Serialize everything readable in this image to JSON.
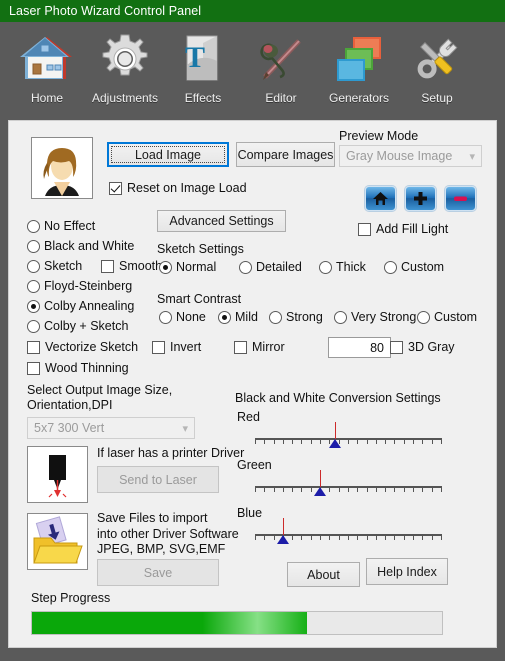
{
  "window": {
    "title": "Laser Photo Wizard Control Panel"
  },
  "toolbar": {
    "items": [
      {
        "label": "Home",
        "icon": "house-icon"
      },
      {
        "label": "Adjustments",
        "icon": "gear-icon"
      },
      {
        "label": "Effects",
        "icon": "text-book-icon"
      },
      {
        "label": "Editor",
        "icon": "pen-pencil-icon"
      },
      {
        "label": "Generators",
        "icon": "layers-icon"
      },
      {
        "label": "Setup",
        "icon": "wrench-screwdriver-icon"
      }
    ]
  },
  "main": {
    "load_image_label": "Load Image",
    "compare_images_label": "Compare Images",
    "reset_on_image_load": {
      "label": "Reset on Image Load",
      "checked": true
    },
    "advanced_settings_label": "Advanced Settings",
    "preview_mode": {
      "label": "Preview Mode",
      "value": "Gray Mouse Image",
      "disabled": true
    },
    "nav_buttons": [
      {
        "name": "home",
        "icon": "home-icon"
      },
      {
        "name": "zoom-in",
        "icon": "plus-icon"
      },
      {
        "name": "zoom-out",
        "icon": "minus-icon"
      }
    ],
    "add_fill_light": {
      "label": "Add Fill Light",
      "checked": false
    },
    "effects": {
      "selected": "Colby Annealing",
      "options": [
        "No Effect",
        "Black and White",
        "Sketch",
        "Floyd-Steinberg",
        "Colby Annealing",
        "Colby + Sketch"
      ]
    },
    "smooth": {
      "label": "Smooth",
      "checked": false
    },
    "sketch_settings": {
      "label": "Sketch Settings",
      "selected": "Normal",
      "options": [
        "Normal",
        "Detailed",
        "Thick",
        "Custom"
      ]
    },
    "smart_contrast": {
      "label": "Smart Contrast",
      "selected": "Mild",
      "options": [
        "None",
        "Mild",
        "Strong",
        "Very Strong",
        "Custom"
      ]
    },
    "vectorize_sketch": {
      "label": "Vectorize Sketch",
      "checked": false
    },
    "wood_thinning": {
      "label": "Wood Thinning",
      "checked": false
    },
    "invert": {
      "label": "Invert",
      "checked": false
    },
    "mirror": {
      "label": "Mirror",
      "checked": false
    },
    "threshold_value": "80",
    "three_d_gray": {
      "label": "3D Gray",
      "checked": false
    },
    "output_size": {
      "label_line1": "Select Output Image Size,",
      "label_line2": "Orientation,DPI",
      "value": "5x7 300 Vert",
      "disabled": true
    },
    "laser": {
      "note": "If laser has a printer Driver",
      "button_label": "Send to Laser",
      "disabled": true,
      "icon": "laser-head-icon"
    },
    "save": {
      "note_line1": "Save Files to import",
      "note_line2": " into other Driver Software",
      "note_line3": "JPEG, BMP, SVG,EMF",
      "button_label": "Save",
      "disabled": true,
      "icon": "save-folder-icon"
    },
    "bw_conversion": {
      "title": "Black and White Conversion Settings",
      "channels": [
        {
          "label": "Red",
          "position": 43
        },
        {
          "label": "Green",
          "position": 35
        },
        {
          "label": "Blue",
          "position": 15
        }
      ],
      "tick_count": 21
    },
    "about_label": "About",
    "help_index_label": "Help Index",
    "step_progress": {
      "label": "Step Progress",
      "percent": 67
    },
    "thumbnail": {
      "icon": "person-avatar-icon"
    }
  },
  "colors": {
    "titlebar": "#127012",
    "toolbar_bg": "#5a5a5a",
    "panel_bg": "#f0f0f0",
    "accent_focus": "#0078d7",
    "progress_green": "#0aa80a",
    "slider_thumb": "#1c1ca8",
    "slider_needle": "#cc2a2a"
  }
}
